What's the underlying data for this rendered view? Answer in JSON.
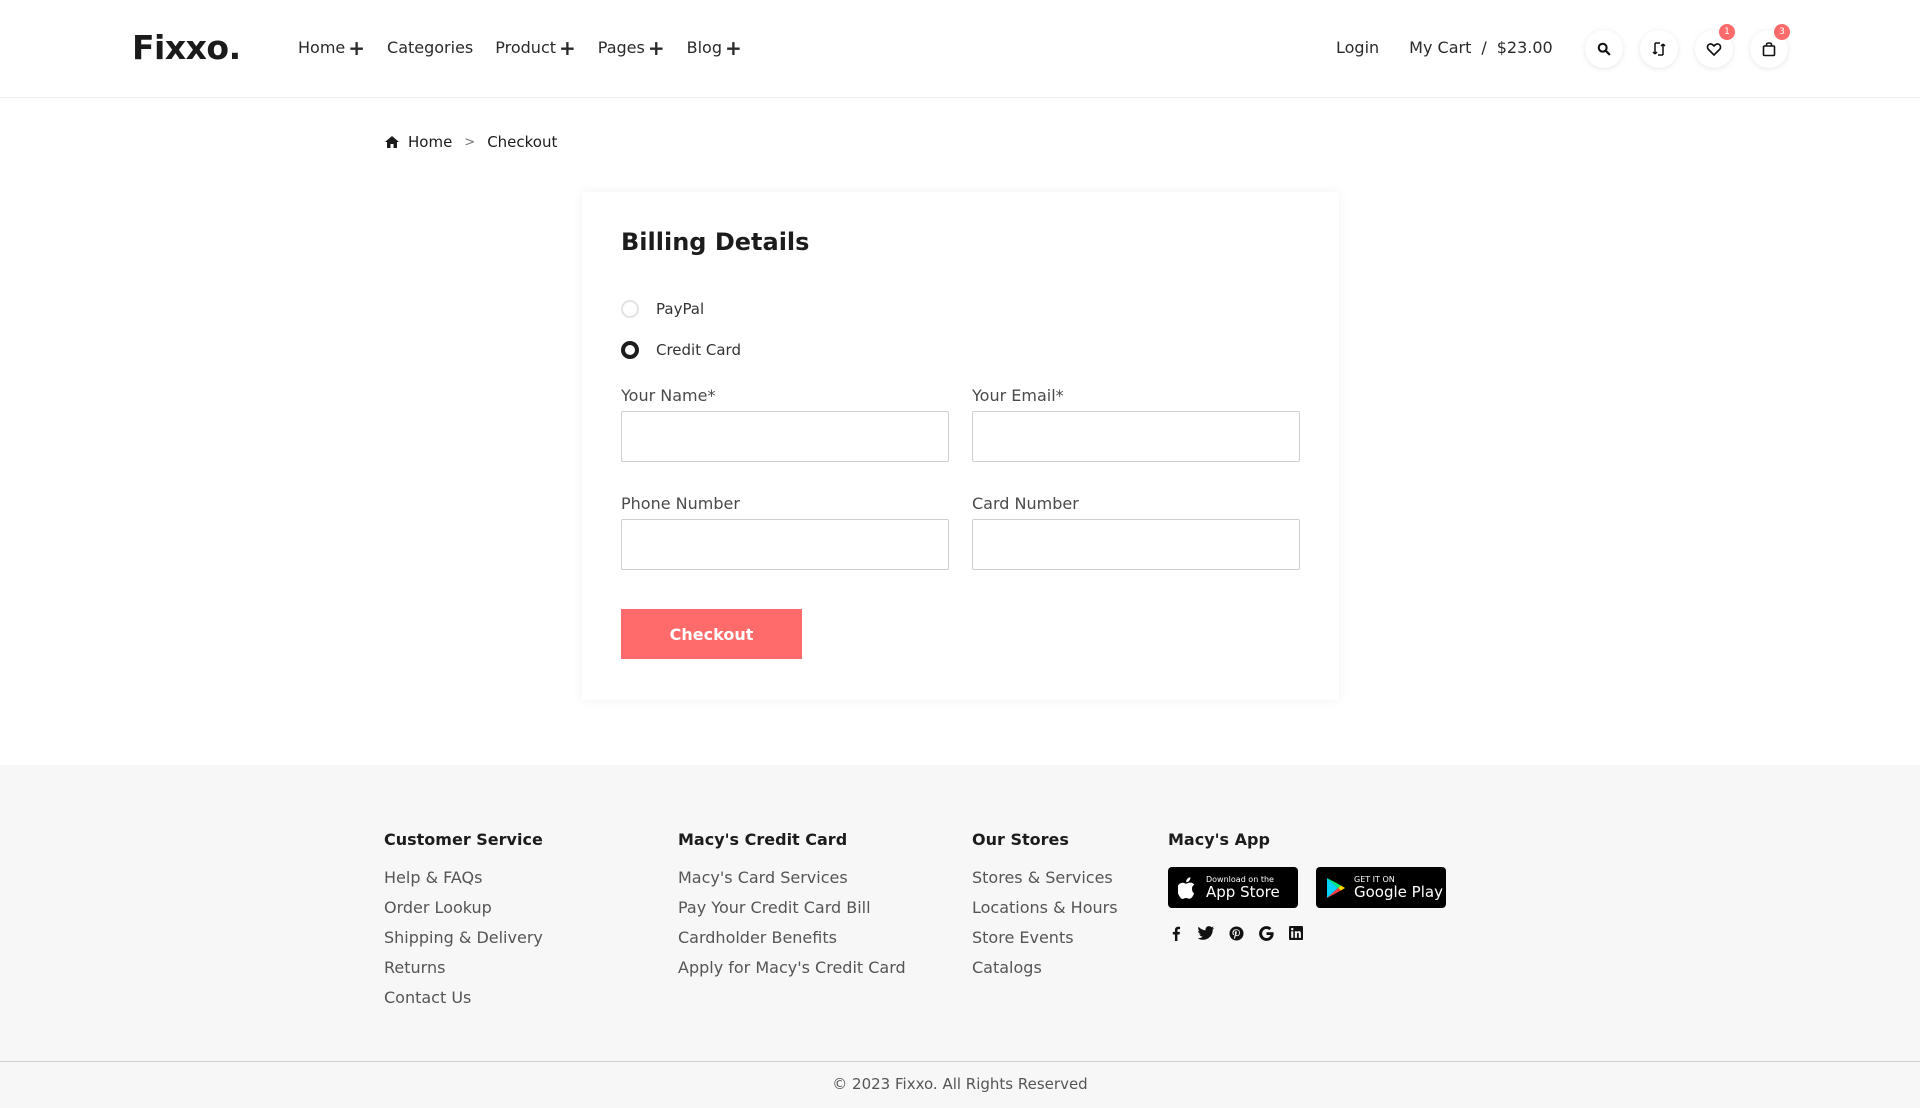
{
  "header": {
    "logo": "Fixxo.",
    "nav": [
      {
        "label": "Home",
        "plus": "+"
      },
      {
        "label": "Categories",
        "plus": ""
      },
      {
        "label": "Product",
        "plus": "+"
      },
      {
        "label": "Pages",
        "plus": "+"
      },
      {
        "label": "Blog",
        "plus": "+"
      }
    ],
    "login": "Login",
    "cart_label": "My Cart",
    "cart_sep": "/",
    "cart_total": "$23.00",
    "icons": [
      "search-icon",
      "compare-icon",
      "heart-icon",
      "bag-icon"
    ],
    "wishlist_count": "1",
    "bag_count": "3"
  },
  "breadcrumb": {
    "home": "Home",
    "separator": ">",
    "current": "Checkout"
  },
  "billing": {
    "title": "Billing Details",
    "payment_options": [
      {
        "label": "PayPal",
        "checked": false
      },
      {
        "label": "Credit Card",
        "checked": true
      }
    ],
    "fields": {
      "name_label": "Your Name*",
      "name_value": "",
      "email_label": "Your Email*",
      "email_value": "",
      "phone_label": "Phone Number",
      "phone_value": "",
      "card_label": "Card Number",
      "card_value": ""
    },
    "checkout_button": "Checkout"
  },
  "footer": {
    "customer_service": {
      "title": "Customer Service",
      "links": [
        "Help & FAQs",
        "Order Lookup",
        "Shipping & Delivery",
        "Returns",
        "Contact Us"
      ]
    },
    "credit_card": {
      "title": "Macy's Credit Card",
      "links": [
        "Macy's Card Services",
        "Pay Your Credit Card Bill",
        "Cardholder Benefits",
        "Apply for Macy's Credit Card"
      ]
    },
    "stores": {
      "title": "Our Stores",
      "links": [
        "Stores & Services",
        "Locations & Hours",
        "Store Events",
        "Catalogs"
      ]
    },
    "app": {
      "title": "Macy's App",
      "app_store_small": "Download on the",
      "app_store_big": "App Store",
      "google_small": "GET IT ON",
      "google_big": "Google Play"
    },
    "socials": [
      "facebook-icon",
      "twitter-icon",
      "pinterest-icon",
      "google-icon",
      "linkedin-icon"
    ],
    "copyright": "© 2023 Fixxo. All Rights Reserved"
  },
  "colors": {
    "accent": "#ff6b6b",
    "text": "#1c1c1c",
    "footer_bg": "#f7f7f7"
  }
}
